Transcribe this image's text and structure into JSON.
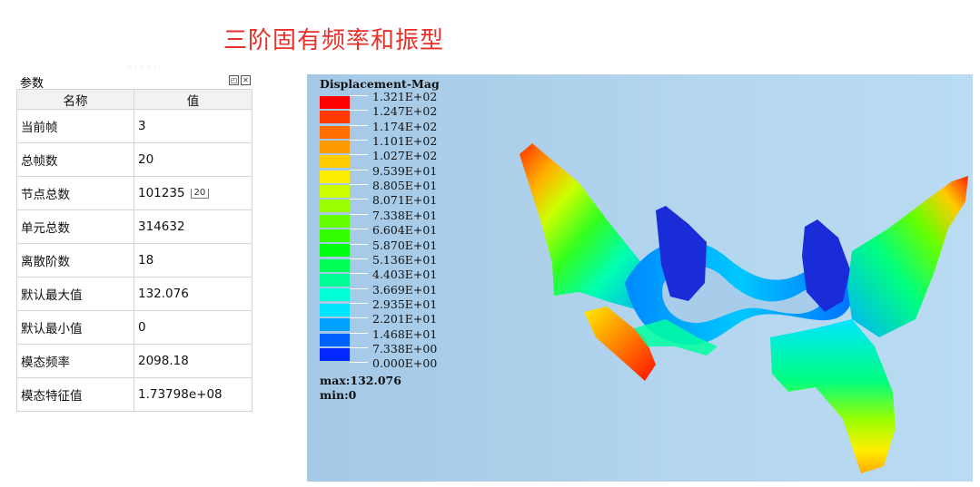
{
  "slide": {
    "title": "三阶固有频率和振型"
  },
  "panel": {
    "title": "参数",
    "columns": [
      "名称",
      "值"
    ],
    "rows": [
      {
        "name": "当前帧",
        "value": "3"
      },
      {
        "name": "总帧数",
        "value": "20"
      },
      {
        "name": "节点总数",
        "value": "101235"
      },
      {
        "name": "单元总数",
        "value": "314632"
      },
      {
        "name": "离散阶数",
        "value": "18"
      },
      {
        "name": "默认最大值",
        "value": "132.076"
      },
      {
        "name": "默认最小值",
        "value": "0"
      },
      {
        "name": "模态频率",
        "value": "2098.18"
      },
      {
        "name": "模态特征值",
        "value": "1.73798e+08"
      }
    ],
    "cell_hint": "20",
    "buttons": {
      "float_icon": "float-window-icon",
      "close_icon": "close-icon"
    }
  },
  "viewer": {
    "legend_title": "Displacement-Mag",
    "legend_labels": [
      "1.321E+02",
      "1.247E+02",
      "1.174E+02",
      "1.101E+02",
      "1.027E+02",
      "9.539E+01",
      "8.805E+01",
      "8.071E+01",
      "7.338E+01",
      "6.604E+01",
      "5.870E+01",
      "5.136E+01",
      "4.403E+01",
      "3.669E+01",
      "2.935E+01",
      "2.201E+01",
      "1.468E+01",
      "7.338E+00",
      "0.000E+00"
    ],
    "legend_colors": [
      "#ff0000",
      "#ff3a00",
      "#ff6e00",
      "#ff9a00",
      "#ffcc00",
      "#ffee00",
      "#ccff00",
      "#99ff00",
      "#66ff00",
      "#33ff00",
      "#00ff10",
      "#00ff55",
      "#00ff99",
      "#00ffd5",
      "#00e5ff",
      "#00a0ff",
      "#0060ff",
      "#0028ff",
      "#0000f0"
    ],
    "max_label": "max:132.076",
    "min_label": "min:0"
  }
}
